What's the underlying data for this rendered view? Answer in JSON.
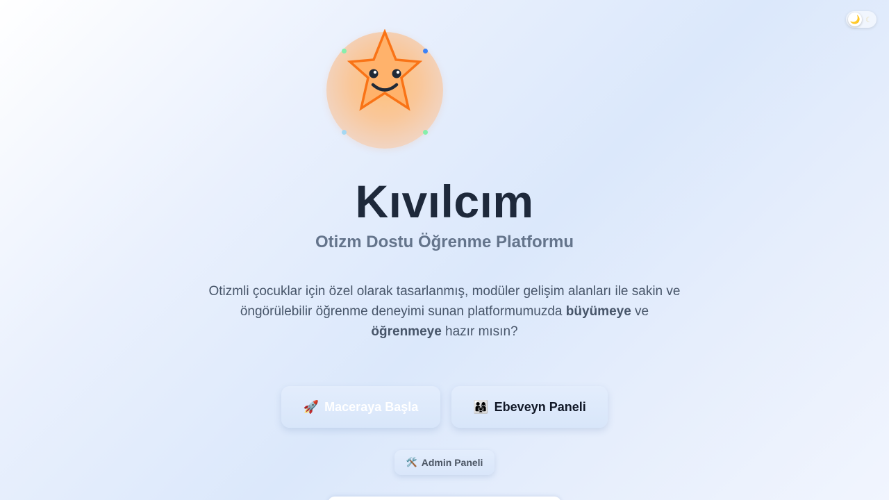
{
  "theme_toggle": {
    "sun_icon": "🌙",
    "moon_icon": "☾"
  },
  "hero": {
    "title": "Kıvılcım",
    "subtitle": "Otizm Dostu Öğrenme Platformu",
    "description_parts": {
      "p1": "Otizmli çocuklar için özel olarak tasarlanmış, modüler gelişim alanları ile sakin ve öngörülebilir öğrenme deneyimi sunan platformumuzda ",
      "b1": "büyümeye",
      "p2": " ve ",
      "b2": "öğrenmeye",
      "p3": " hazır mısın?"
    }
  },
  "buttons": {
    "start": {
      "icon": "🚀",
      "label": "Maceraya Başla"
    },
    "parent": {
      "icon": "👨‍👩‍👧",
      "label": "Ebeveyn Paneli"
    },
    "admin": {
      "icon": "🛠️",
      "label": "Admin Paneli"
    }
  },
  "colors": {
    "title": "#1e293b",
    "subtitle": "#64748b",
    "star_outline": "#f97316",
    "star_fill": "#ffb26b"
  }
}
